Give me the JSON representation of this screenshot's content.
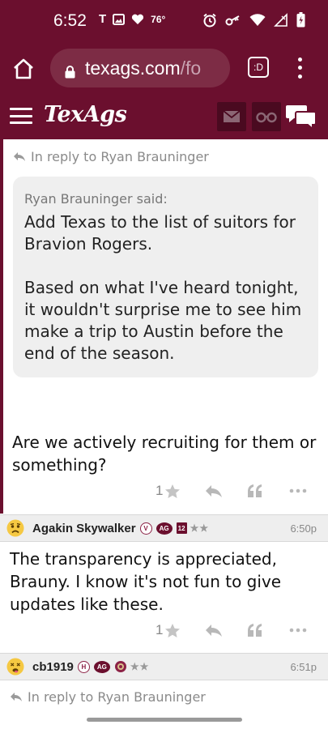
{
  "status_bar": {
    "time": "6:52",
    "temperature": "76°"
  },
  "browser": {
    "url_main": "texags.com",
    "url_fade": "/fo",
    "tabs_label": ":D"
  },
  "site": {
    "logo": "TexAgs"
  },
  "first_post": {
    "reply_to": "In reply to Ryan Brauninger",
    "quote_author": "Ryan Brauninger said:",
    "quote_text": "Add Texas to the list of suitors for Bravion Rogers.\n\nBased on what I've heard tonight, it wouldn't surprise me to see him make a trip to Austin before the end of the season.",
    "body": "Are we actively recruiting for them or something?",
    "star_count": "1"
  },
  "second_post": {
    "username": "Agakin Skywalker",
    "badges": [
      "V",
      "AG",
      "12"
    ],
    "stars": "★★",
    "time": "6:50p",
    "body": "The transparency is appreciated, Brauny. I know it's not fun to give updates like these.",
    "star_count": "1"
  },
  "third_post": {
    "username": "cb1919",
    "badges": [
      "H",
      "AG"
    ],
    "stars": "★★",
    "time": "6:51p",
    "reply_to": "In reply to Ryan Brauninger"
  },
  "colors": {
    "maroon": "#6b0f2e",
    "url_pill": "#7d2c45",
    "header_button": "#4a0a20"
  }
}
